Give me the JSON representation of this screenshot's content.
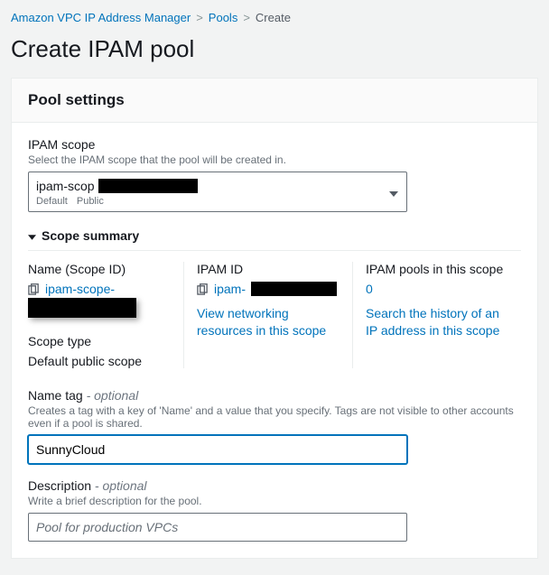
{
  "breadcrumb": {
    "root": "Amazon VPC IP Address Manager",
    "level2": "Pools",
    "current": "Create",
    "sep": ">"
  },
  "page_title": "Create IPAM pool",
  "panel": {
    "header": "Pool settings",
    "ipam_scope": {
      "label": "IPAM scope",
      "hint": "Select the IPAM scope that the pool will be created in.",
      "selected_prefix": "ipam-scop",
      "sub_left": "Default",
      "sub_right": "Public"
    },
    "summary": {
      "title": "Scope summary",
      "name": {
        "label": "Name (Scope ID)",
        "link_text": "ipam-scope-"
      },
      "ipam_id": {
        "label": "IPAM ID",
        "link_text": "ipam-",
        "link2": "View networking resources in this scope"
      },
      "pools": {
        "label": "IPAM pools in this scope",
        "count": "0",
        "link2": "Search the history of an IP address in this scope"
      },
      "scope_type": {
        "label": "Scope type",
        "value": "Default public scope"
      }
    },
    "name_tag": {
      "label": "Name tag",
      "optional": " - optional",
      "hint": "Creates a tag with a key of 'Name' and a value that you specify. Tags are not visible to other accounts even if a pool is shared.",
      "value": "SunnyCloud"
    },
    "description": {
      "label": "Description",
      "optional": " - optional",
      "hint": "Write a brief description for the pool.",
      "placeholder": "Pool for production VPCs"
    }
  }
}
